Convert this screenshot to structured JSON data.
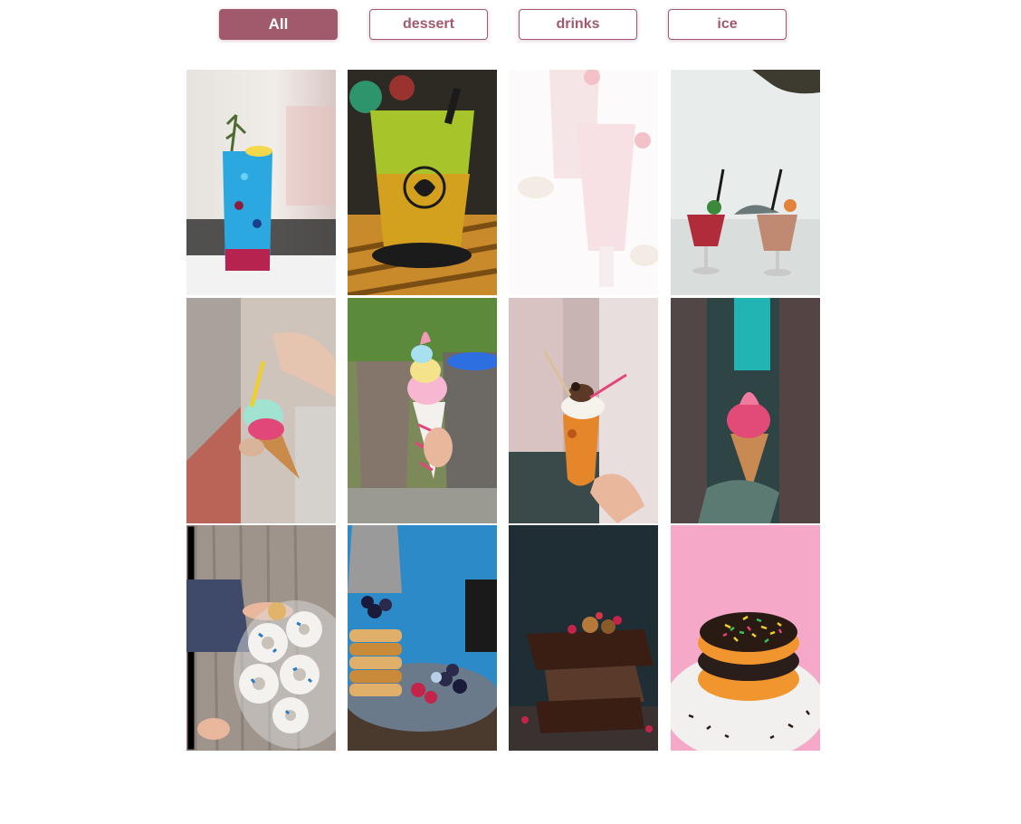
{
  "filters": {
    "items": [
      {
        "label": "All",
        "active": true
      },
      {
        "label": "dessert",
        "active": false
      },
      {
        "label": "drinks",
        "active": false
      },
      {
        "label": "ice",
        "active": false
      }
    ]
  },
  "colors": {
    "accent": "#a15a6c",
    "background": "#ffffff"
  },
  "gallery": {
    "photos": [
      {
        "subject": "blue-cocktail"
      },
      {
        "subject": "green-iced-drink"
      },
      {
        "subject": "pink-milkshakes"
      },
      {
        "subject": "beach-drinks"
      },
      {
        "subject": "mint-ice-cream-cone"
      },
      {
        "subject": "rainbow-soft-serve"
      },
      {
        "subject": "taiyaki-ice-cream"
      },
      {
        "subject": "pink-soft-serve"
      },
      {
        "subject": "donuts-and-child"
      },
      {
        "subject": "blueberry-pancakes"
      },
      {
        "subject": "chocolate-brownies"
      },
      {
        "subject": "sprinkle-donut"
      }
    ]
  }
}
